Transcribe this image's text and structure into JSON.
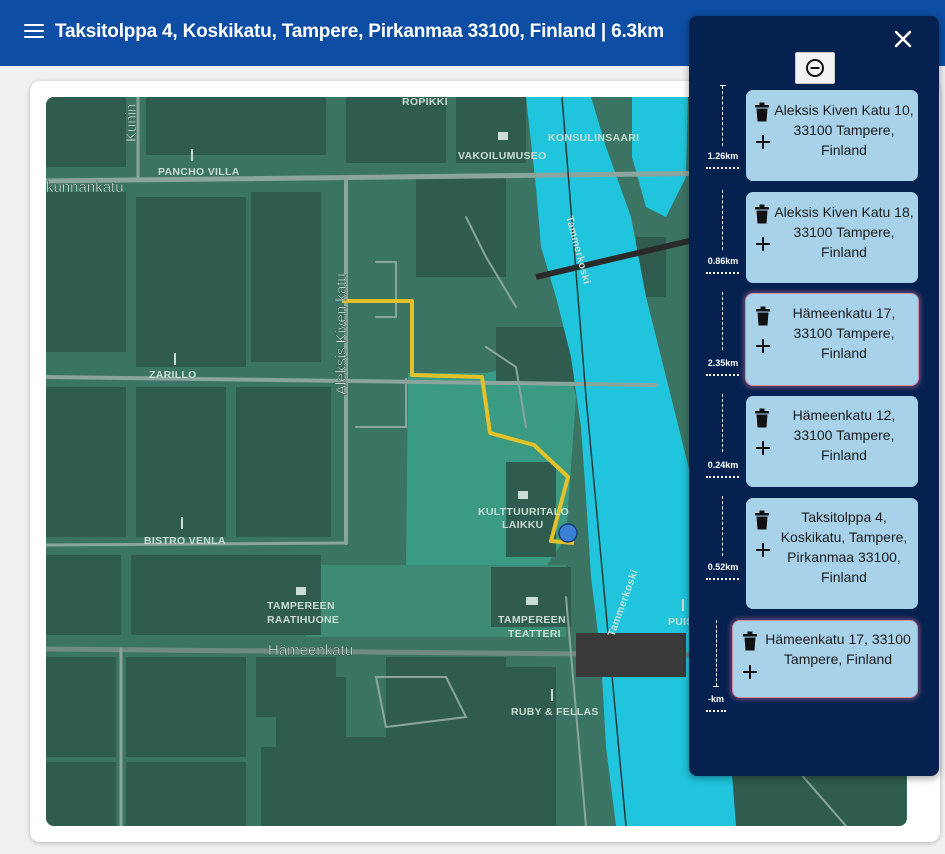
{
  "header": {
    "title": "Taksitolppa 4, Koskikatu, Tampere, Pirkanmaa 33100, Finland | 6.3km"
  },
  "map": {
    "labels": {
      "kunin": "Kunin",
      "kunnankatu": "kunnankatu",
      "ropikki": "ROPIKKI",
      "konsulinsaari": "KONSULINSAARI",
      "vakoilumuseo": "VAKOILUMUSEO",
      "panchovilla": "PANCHO VILLA",
      "tammerkoski1": "Tammerkoski",
      "aleksiskivenkatu": "Aleksis Kiven katu",
      "zarillo": "ZARILLO",
      "kulttuuritalo_1": "KULTTUURITALO",
      "kulttuuritalo_2": "LAIKKU",
      "bistrovenla": "BISTRO VENLA",
      "raatihuone_1": "TAMPEREEN",
      "raatihuone_2": "RAATIHUONE",
      "teatteri_1": "TAMPEREEN",
      "teatteri_2": "TEATTERI",
      "tammerkoski2": "Tammerkoski",
      "puis": "PUIS",
      "hameenkatu": "Hämeenkatu",
      "rubyfellas": "RUBY & FELLAS"
    },
    "colors": {
      "land": "#3c7463",
      "park": "#3a9a82",
      "building": "#2f5c4f",
      "water": "#20c5dd",
      "road": "#8aa59d",
      "route": "#e2c12b"
    }
  },
  "panel": {
    "stops": [
      {
        "lines": [
          "Aleksis Kiven Katu 10,",
          "33100 Tampere,",
          "Finland"
        ],
        "distance": "1.26km"
      },
      {
        "lines": [
          "Aleksis Kiven Katu 18,",
          "33100 Tampere,",
          "Finland"
        ],
        "distance": "0.86km"
      },
      {
        "lines": [
          "Hämeenkatu 17,",
          "33100 Tampere,",
          "Finland"
        ],
        "distance": "2.35km"
      },
      {
        "lines": [
          "Hämeenkatu 12,",
          "33100 Tampere,",
          "Finland"
        ],
        "distance": "0.24km"
      },
      {
        "lines": [
          "Taksitolppa 4,",
          "Koskikatu, Tampere,",
          "Pirkanmaa 33100,",
          "Finland"
        ],
        "distance": "0.52km"
      },
      {
        "lines": [
          "Hämeenkatu 17, 33100",
          "Tampere, Finland"
        ],
        "distance": "-km"
      }
    ]
  }
}
